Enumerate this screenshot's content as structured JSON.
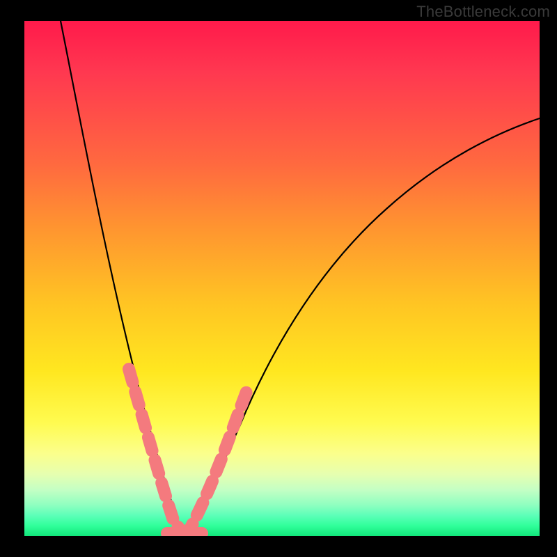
{
  "watermark": "TheBottleneck.com",
  "chart_data": {
    "type": "line",
    "title": "",
    "xlabel": "",
    "ylabel": "",
    "xlim": [
      0,
      100
    ],
    "ylim": [
      0,
      100
    ],
    "grid": false,
    "series": [
      {
        "name": "left-curve",
        "x": [
          7,
          10,
          14,
          18,
          21,
          23,
          25,
          27,
          28.5,
          29.5,
          30.2,
          31
        ],
        "y": [
          100,
          80,
          55,
          35,
          22,
          14,
          9,
          5,
          3,
          1.5,
          0.8,
          0
        ]
      },
      {
        "name": "right-curve",
        "x": [
          31,
          33,
          36,
          40,
          45,
          52,
          60,
          70,
          82,
          95,
          100
        ],
        "y": [
          0,
          3,
          10,
          22,
          35,
          48,
          58,
          67,
          74,
          79,
          81
        ]
      },
      {
        "name": "marker-band-left",
        "x": [
          22,
          23.5,
          25,
          26.5,
          28,
          29.5,
          31
        ],
        "y": [
          31,
          24,
          18,
          12,
          7,
          3,
          0
        ]
      },
      {
        "name": "marker-band-right",
        "x": [
          31,
          33,
          35,
          37,
          39,
          41,
          42.5
        ],
        "y": [
          0,
          5,
          11,
          18,
          25,
          31,
          35
        ]
      }
    ],
    "background_gradient": {
      "top": "#ff1a4b",
      "upper_mid": "#ff9430",
      "mid": "#ffe720",
      "lower_mid": "#fbff8c",
      "bottom": "#11e57a"
    }
  }
}
